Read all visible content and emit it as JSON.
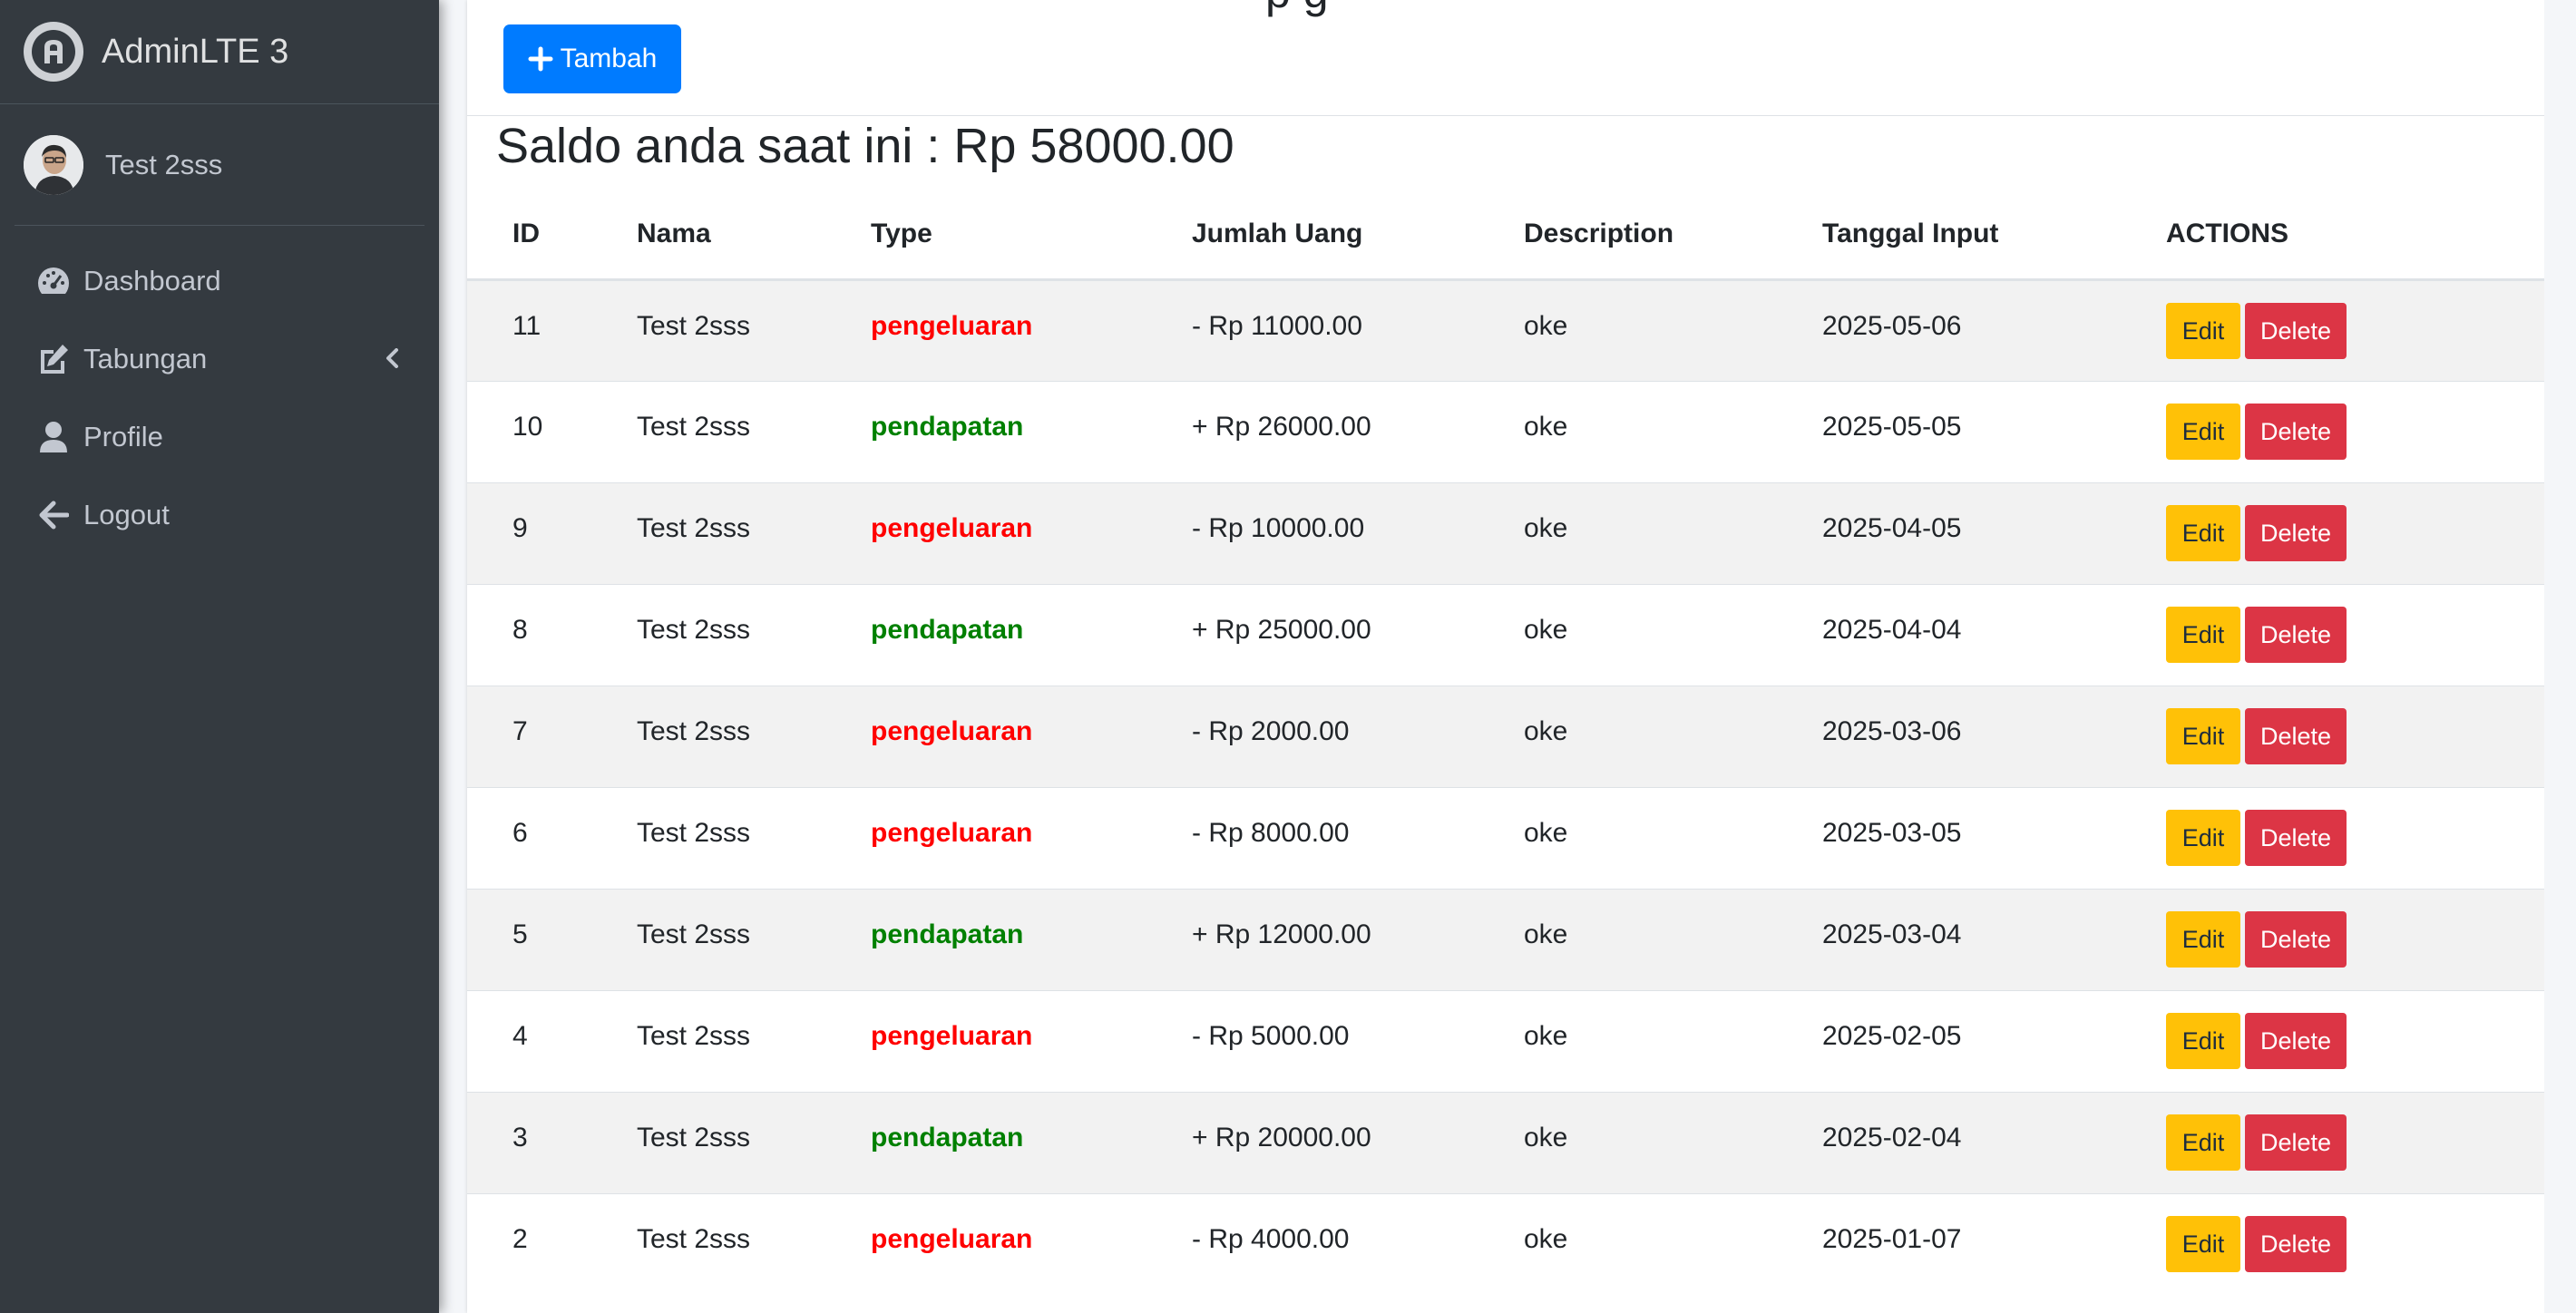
{
  "brand": {
    "name": "AdminLTE 3",
    "icon": "adminlte-logo-icon"
  },
  "user": {
    "name": "Test 2sss"
  },
  "nav": [
    {
      "label": "Dashboard",
      "icon": "tachometer-icon"
    },
    {
      "label": "Tabungan",
      "icon": "edit-icon"
    },
    {
      "label": "Profile",
      "icon": "user-icon"
    },
    {
      "label": "Logout",
      "icon": "arrow-left-icon"
    }
  ],
  "header": {
    "title_partial": "p              g",
    "add_button": "Tambah"
  },
  "saldo": "Saldo anda saat ini : Rp 58000.00",
  "table": {
    "headers": [
      "ID",
      "Nama",
      "Type",
      "Jumlah Uang",
      "Description",
      "Tanggal Input",
      "ACTIONS"
    ],
    "rows": [
      {
        "id": "11",
        "nama": "Test 2sss",
        "type": "pengeluaran",
        "jumlah": "- Rp 11000.00",
        "desc": "oke",
        "tanggal": "2025-05-06",
        "edit": "Edit",
        "delete": "Delete"
      },
      {
        "id": "10",
        "nama": "Test 2sss",
        "type": "pendapatan",
        "jumlah": "+ Rp 26000.00",
        "desc": "oke",
        "tanggal": "2025-05-05",
        "edit": "Edit",
        "delete": "Delete"
      },
      {
        "id": "9",
        "nama": "Test 2sss",
        "type": "pengeluaran",
        "jumlah": "- Rp 10000.00",
        "desc": "oke",
        "tanggal": "2025-04-05",
        "edit": "Edit",
        "delete": "Delete"
      },
      {
        "id": "8",
        "nama": "Test 2sss",
        "type": "pendapatan",
        "jumlah": "+ Rp 25000.00",
        "desc": "oke",
        "tanggal": "2025-04-04",
        "edit": "Edit",
        "delete": "Delete"
      },
      {
        "id": "7",
        "nama": "Test 2sss",
        "type": "pengeluaran",
        "jumlah": "- Rp 2000.00",
        "desc": "oke",
        "tanggal": "2025-03-06",
        "edit": "Edit",
        "delete": "Delete"
      },
      {
        "id": "6",
        "nama": "Test 2sss",
        "type": "pengeluaran",
        "jumlah": "- Rp 8000.00",
        "desc": "oke",
        "tanggal": "2025-03-05",
        "edit": "Edit",
        "delete": "Delete"
      },
      {
        "id": "5",
        "nama": "Test 2sss",
        "type": "pendapatan",
        "jumlah": "+ Rp 12000.00",
        "desc": "oke",
        "tanggal": "2025-03-04",
        "edit": "Edit",
        "delete": "Delete"
      },
      {
        "id": "4",
        "nama": "Test 2sss",
        "type": "pengeluaran",
        "jumlah": "- Rp 5000.00",
        "desc": "oke",
        "tanggal": "2025-02-05",
        "edit": "Edit",
        "delete": "Delete"
      },
      {
        "id": "3",
        "nama": "Test 2sss",
        "type": "pendapatan",
        "jumlah": "+ Rp 20000.00",
        "desc": "oke",
        "tanggal": "2025-02-04",
        "edit": "Edit",
        "delete": "Delete"
      },
      {
        "id": "2",
        "nama": "Test 2sss",
        "type": "pengeluaran",
        "jumlah": "- Rp 4000.00",
        "desc": "oke",
        "tanggal": "2025-01-07",
        "edit": "Edit",
        "delete": "Delete"
      }
    ]
  },
  "colors": {
    "sidebar_bg": "#343a40",
    "primary": "#007bff",
    "warning": "#ffc107",
    "danger": "#dc3545",
    "expense": "#ff0000",
    "income": "#008000"
  }
}
